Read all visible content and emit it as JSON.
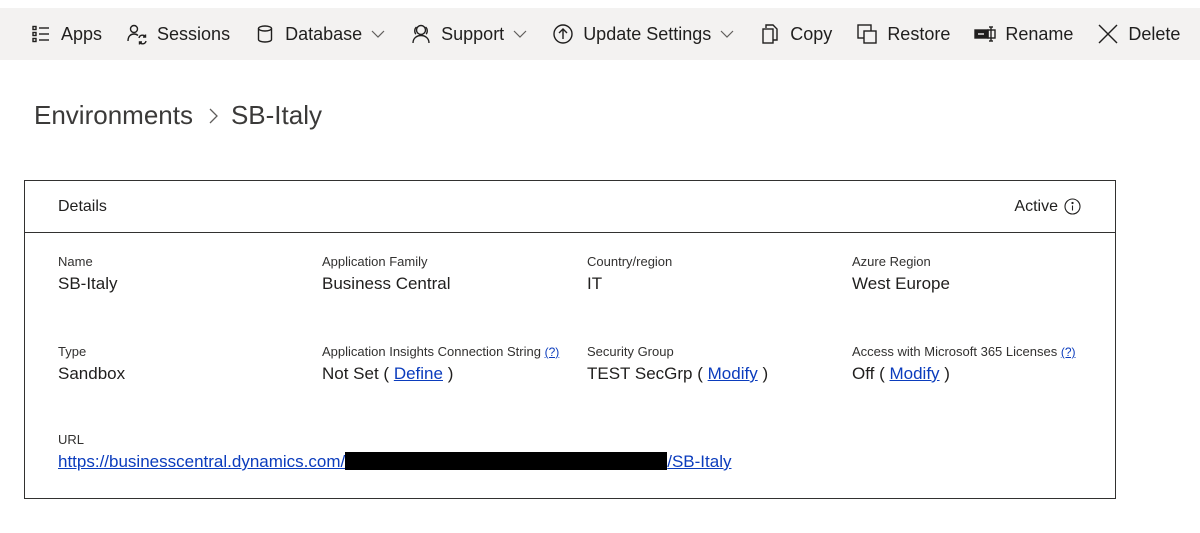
{
  "toolbar": {
    "items": [
      {
        "label": "Apps",
        "icon": "apps-list-icon",
        "dropdown": false
      },
      {
        "label": "Sessions",
        "icon": "sessions-icon",
        "dropdown": false
      },
      {
        "label": "Database",
        "icon": "database-icon",
        "dropdown": true
      },
      {
        "label": "Support",
        "icon": "support-person-icon",
        "dropdown": true
      },
      {
        "label": "Update Settings",
        "icon": "arrow-up-circle-icon",
        "dropdown": true
      },
      {
        "label": "Copy",
        "icon": "copy-icon",
        "dropdown": false
      },
      {
        "label": "Restore",
        "icon": "restore-icon",
        "dropdown": false
      },
      {
        "label": "Rename",
        "icon": "rename-icon",
        "dropdown": false
      },
      {
        "label": "Delete",
        "icon": "close-x-icon",
        "dropdown": false
      }
    ]
  },
  "breadcrumb": {
    "parent": "Environments",
    "current": "SB-Italy"
  },
  "details": {
    "title": "Details",
    "status": "Active",
    "name_label": "Name",
    "name_value": "SB-Italy",
    "app_family_label": "Application Family",
    "app_family_value": "Business Central",
    "country_label": "Country/region",
    "country_value": "IT",
    "azure_region_label": "Azure Region",
    "azure_region_value": "West Europe",
    "type_label": "Type",
    "type_value": "Sandbox",
    "insights_label": "Application Insights Connection String",
    "insights_help": "(?)",
    "insights_value_prefix": "Not Set (",
    "insights_link": "Define",
    "insights_value_suffix": ")",
    "security_label": "Security Group",
    "security_value_prefix": "TEST SecGrp (",
    "security_link": "Modify",
    "security_value_suffix": ")",
    "m365_label": "Access with Microsoft 365 Licenses",
    "m365_help": "(?)",
    "m365_value_prefix": "Off (",
    "m365_link": "Modify",
    "m365_value_suffix": ")",
    "url_label": "URL",
    "url_prefix": "https://businesscentral.dynamics.com/",
    "url_suffix": "/SB-Italy"
  },
  "colors": {
    "toolbar_bg": "#f3f2f1",
    "link": "#0b3cbd",
    "border": "#323130"
  }
}
